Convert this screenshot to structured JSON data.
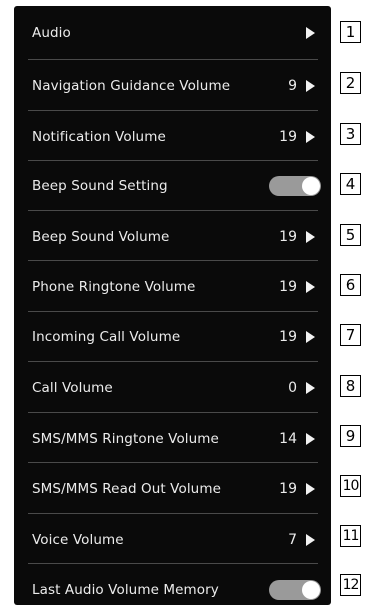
{
  "settings": [
    {
      "label": "Audio",
      "value": "",
      "control": "arrow",
      "callout": "1"
    },
    {
      "label": "Navigation Guidance Volume",
      "value": "9",
      "control": "arrow",
      "callout": "2"
    },
    {
      "label": "Notification Volume",
      "value": "19",
      "control": "arrow",
      "callout": "3"
    },
    {
      "label": "Beep Sound Setting",
      "value": "",
      "control": "toggle",
      "toggle_state": "on",
      "callout": "4"
    },
    {
      "label": "Beep Sound Volume",
      "value": "19",
      "control": "arrow",
      "callout": "5"
    },
    {
      "label": "Phone Ringtone Volume",
      "value": "19",
      "control": "arrow",
      "callout": "6"
    },
    {
      "label": "Incoming Call Volume",
      "value": "19",
      "control": "arrow",
      "callout": "7"
    },
    {
      "label": "Call Volume",
      "value": "0",
      "control": "arrow",
      "callout": "8"
    },
    {
      "label": "SMS/MMS Ringtone Volume",
      "value": "14",
      "control": "arrow",
      "callout": "9"
    },
    {
      "label": "SMS/MMS Read Out Volume",
      "value": "19",
      "control": "arrow",
      "callout": "10"
    },
    {
      "label": "Voice Volume",
      "value": "7",
      "control": "arrow",
      "callout": "11"
    },
    {
      "label": "Last Audio Volume Memory",
      "value": "",
      "control": "toggle",
      "toggle_state": "on",
      "callout": "12"
    }
  ],
  "colors": {
    "panel_bg": "#0a0a0a",
    "text": "#ececec",
    "toggle_track": "#9a9a9a",
    "divider": "#4a4a4a"
  }
}
